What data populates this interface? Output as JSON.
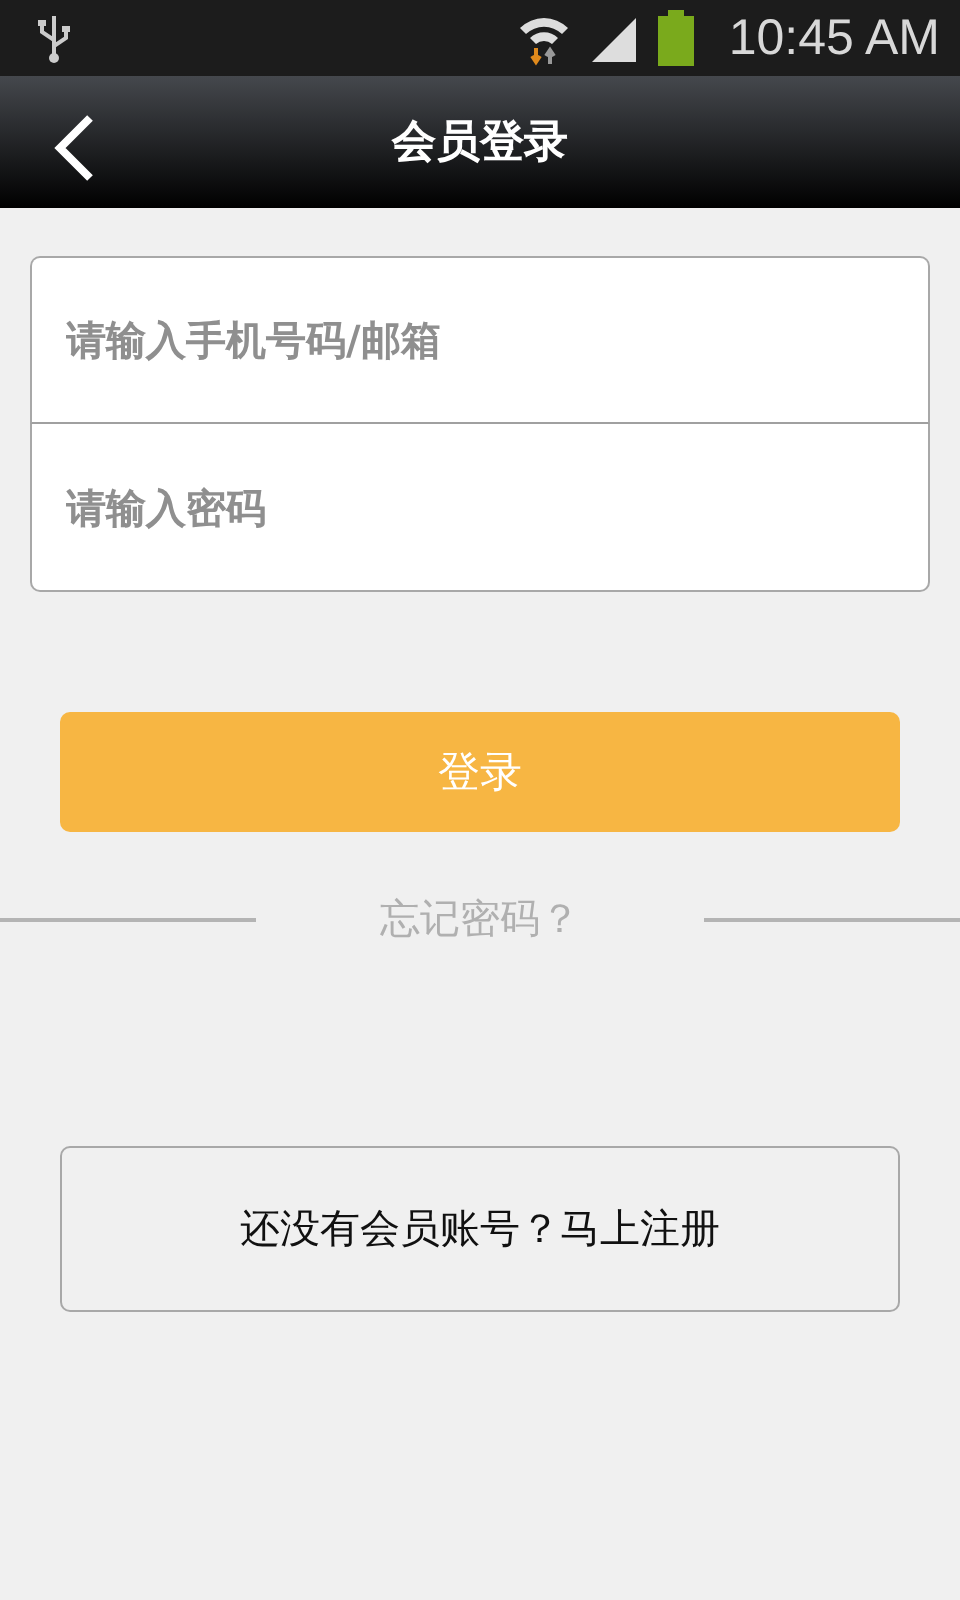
{
  "status_bar": {
    "time": "10:45 AM"
  },
  "header": {
    "title": "会员登录"
  },
  "form": {
    "fields": [
      {
        "placeholder": "请输入手机号码/邮箱"
      },
      {
        "placeholder": "请输入密码"
      }
    ]
  },
  "login_button": "登录",
  "forgot_link": "忘记密码？",
  "register_button": "还没有会员账号？马上注册"
}
